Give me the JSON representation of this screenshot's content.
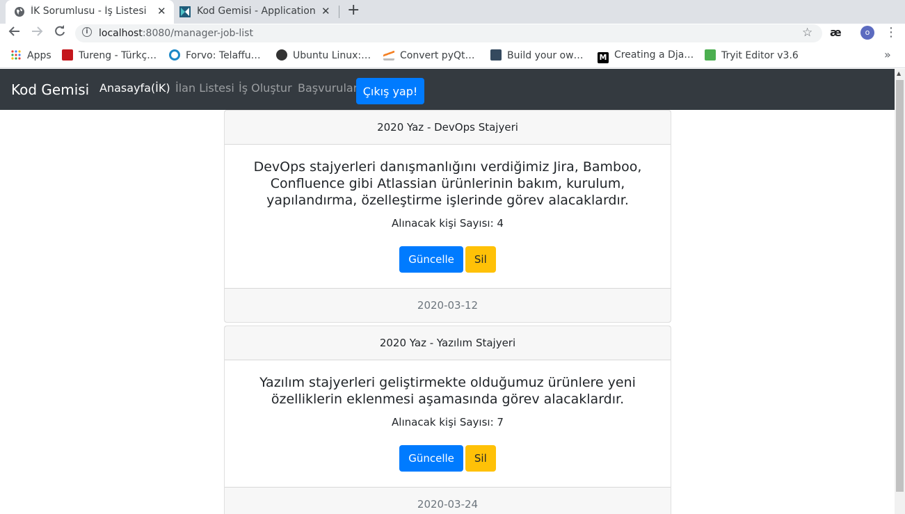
{
  "browser": {
    "tabs": [
      {
        "title": "İK Sorumlusu - İş Listesi",
        "active": true,
        "icon": "globe-icon"
      },
      {
        "title": "Kod Gemisi - Application",
        "active": false,
        "icon": "app-logo-icon"
      }
    ],
    "close_glyph": "✕",
    "new_tab_glyph": "+",
    "address": {
      "host": "localhost",
      "path": ":8080/manager-job-list"
    },
    "extension_label": "æ",
    "profile_initial": "o",
    "bookmarks": [
      {
        "label": "Apps",
        "icon": "apps-grid-icon",
        "color": "#4285f4"
      },
      {
        "label": "Tureng - Türkç…",
        "icon": "tureng-icon",
        "color": "#c4161c"
      },
      {
        "label": "Forvo: Telaffu…",
        "icon": "forvo-icon",
        "color": "#1c88c7"
      },
      {
        "label": "Ubuntu Linux:…",
        "icon": "linux-icon",
        "color": "#333333"
      },
      {
        "label": "Convert pyQt…",
        "icon": "stackoverflow-icon",
        "color": "#f48024"
      },
      {
        "label": "Build your ow…",
        "icon": "bookmark-page-icon",
        "color": "#34495e"
      },
      {
        "label": "Creating a Dja…",
        "icon": "medium-icon",
        "color": "#000000"
      },
      {
        "label": "Tryit Editor v3.6",
        "icon": "w3schools-icon",
        "color": "#4caf50"
      }
    ],
    "bookmarks_more": "»"
  },
  "navbar": {
    "brand": "Kod Gemisi",
    "links": [
      {
        "label": "Anasayfa(İK)",
        "active": true
      },
      {
        "label": "İlan Listesi",
        "active": false
      },
      {
        "label": "İş Oluştur",
        "active": false
      },
      {
        "label": "Başvurular",
        "active": false
      }
    ],
    "logout_label": "Çıkış yap!"
  },
  "jobs": [
    {
      "title": "2020 Yaz - DevOps Stajyeri",
      "description": "DevOps stajyerleri danışmanlığını verdiğimiz Jira, Bamboo, Confluence gibi Atlassian ürünlerinin bakım, kurulum, yapılandırma, özelleştirme işlerinde görev alacaklardır.",
      "count_text": "Alınacak kişi Sayısı: 4",
      "update_label": "Güncelle",
      "delete_label": "Sil",
      "date": "2020-03-12"
    },
    {
      "title": "2020 Yaz - Yazılım Stajyeri",
      "description": "Yazılım stajyerleri geliştirmekte olduğumuz ürünlere yeni özelliklerin eklenmesi aşamasında görev alacaklardır.",
      "count_text": "Alınacak kişi Sayısı: 7",
      "update_label": "Güncelle",
      "delete_label": "Sil",
      "date": "2020-03-24"
    }
  ],
  "colors": {
    "navbar_bg": "#343a40",
    "primary": "#007bff",
    "warning": "#ffc107"
  }
}
